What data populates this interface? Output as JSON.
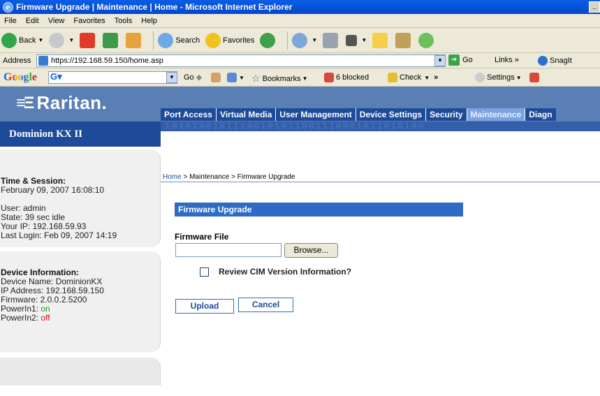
{
  "window": {
    "title": "Firmware Upgrade | Maintenance | Home - Microsoft Internet Explorer"
  },
  "menu": [
    "File",
    "Edit",
    "View",
    "Favorites",
    "Tools",
    "Help"
  ],
  "toolbar": {
    "back": "Back",
    "search": "Search",
    "favorites": "Favorites"
  },
  "address": {
    "label": "Address",
    "url": "https://192.168.59.150/home.asp",
    "go": "Go",
    "links": "Links",
    "snagit": "SnagIt"
  },
  "google": {
    "logo": "Google",
    "g_button": "G",
    "go": "Go",
    "bookmarks": "Bookmarks",
    "blocked": "6 blocked",
    "check": "Check",
    "settings": "Settings"
  },
  "brand": {
    "logo": "Raritan.",
    "product": "Dominion KX II"
  },
  "nav": {
    "tabs": [
      "Port Access",
      "Virtual Media",
      "User Management",
      "Device Settings",
      "Security",
      "Maintenance",
      "Diagn"
    ],
    "active": "Maintenance"
  },
  "breadcrumb": {
    "home": "Home",
    "rest": " > Maintenance > Firmware Upgrade"
  },
  "session": {
    "heading": "Time & Session:",
    "datetime": "February 09, 2007 16:08:10",
    "user": "User: admin",
    "state": "State: 39 sec idle",
    "ip": "Your IP: 192.168.59.93",
    "last_login": "Last Login: Feb 09, 2007 14:19"
  },
  "device": {
    "heading": "Device Information:",
    "name": "Device Name: DominionKX",
    "ip": "IP Address: 192.168.59.150",
    "firmware": "Firmware: 2.0.0.2.5200",
    "power1_label": "PowerIn1: ",
    "power1_value": "on",
    "power2_label": "PowerIn2: ",
    "power2_value": "off"
  },
  "firmware": {
    "section_title": "Firmware Upgrade",
    "file_label": "Firmware File",
    "file_value": "",
    "browse": "Browse...",
    "review_label": "Review CIM Version Information?",
    "upload": "Upload",
    "cancel": "Cancel"
  },
  "colors": {
    "header_bg": "#5a7fb5",
    "nav_bg": "#1d4b9a",
    "active_tab": "#7ba3e0",
    "power_on": "#1a9a1a",
    "power_off": "#e01010"
  }
}
